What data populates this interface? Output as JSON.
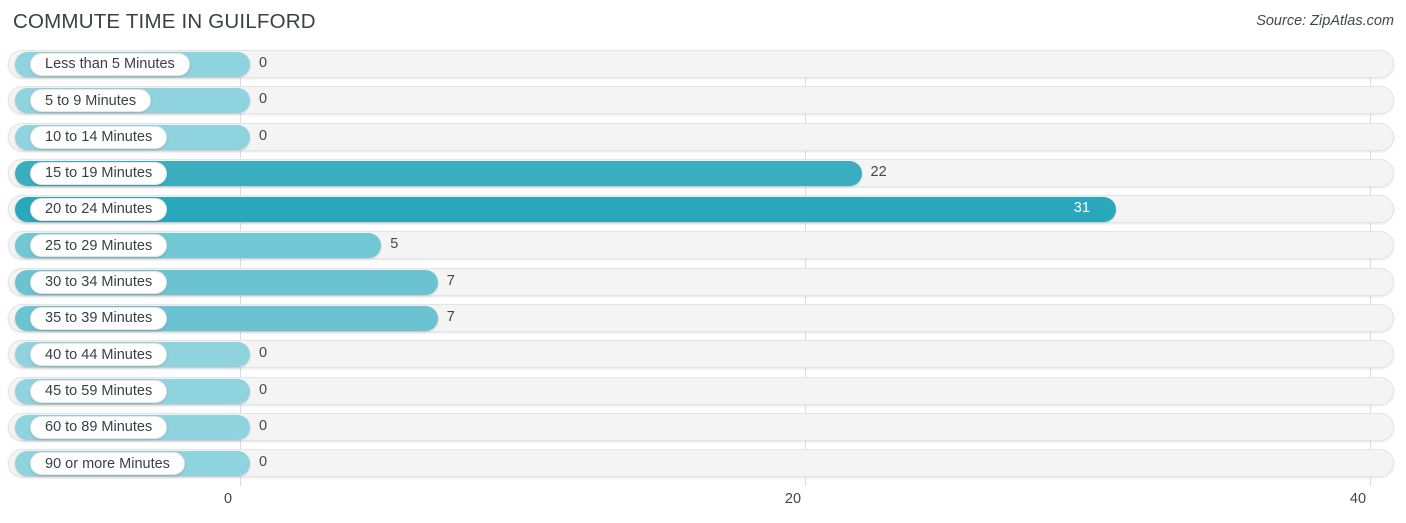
{
  "header": {
    "title": "COMMUTE TIME IN GUILFORD",
    "source": "Source: ZipAtlas.com"
  },
  "chart_data": {
    "type": "bar",
    "orientation": "horizontal",
    "title": "COMMUTE TIME IN GUILFORD",
    "xlabel": "",
    "ylabel": "",
    "xlim": [
      0,
      40
    ],
    "xticks": [
      0,
      20,
      40
    ],
    "xtick_labels": [
      "0",
      "20",
      "40"
    ],
    "grid": true,
    "legend": false,
    "categories": [
      "Less than 5 Minutes",
      "5 to 9 Minutes",
      "10 to 14 Minutes",
      "15 to 19 Minutes",
      "20 to 24 Minutes",
      "25 to 29 Minutes",
      "30 to 34 Minutes",
      "35 to 39 Minutes",
      "40 to 44 Minutes",
      "45 to 59 Minutes",
      "60 to 89 Minutes",
      "90 or more Minutes"
    ],
    "values": [
      0,
      0,
      0,
      22,
      31,
      5,
      7,
      7,
      0,
      0,
      0,
      0
    ],
    "value_labels": [
      "0",
      "0",
      "0",
      "22",
      "31",
      "5",
      "7",
      "7",
      "0",
      "0",
      "0",
      "0"
    ],
    "bar_colors": [
      "#8ed3de",
      "#8ed3de",
      "#8ed3de",
      "#3aadbf",
      "#29a8bc",
      "#72c7d5",
      "#6bc3d2",
      "#6bc3d2",
      "#8ed3de",
      "#8ed3de",
      "#8ed3de",
      "#8ed3de"
    ],
    "track_color": "#f4f4f4",
    "grid_color": "#dcdcdc"
  }
}
